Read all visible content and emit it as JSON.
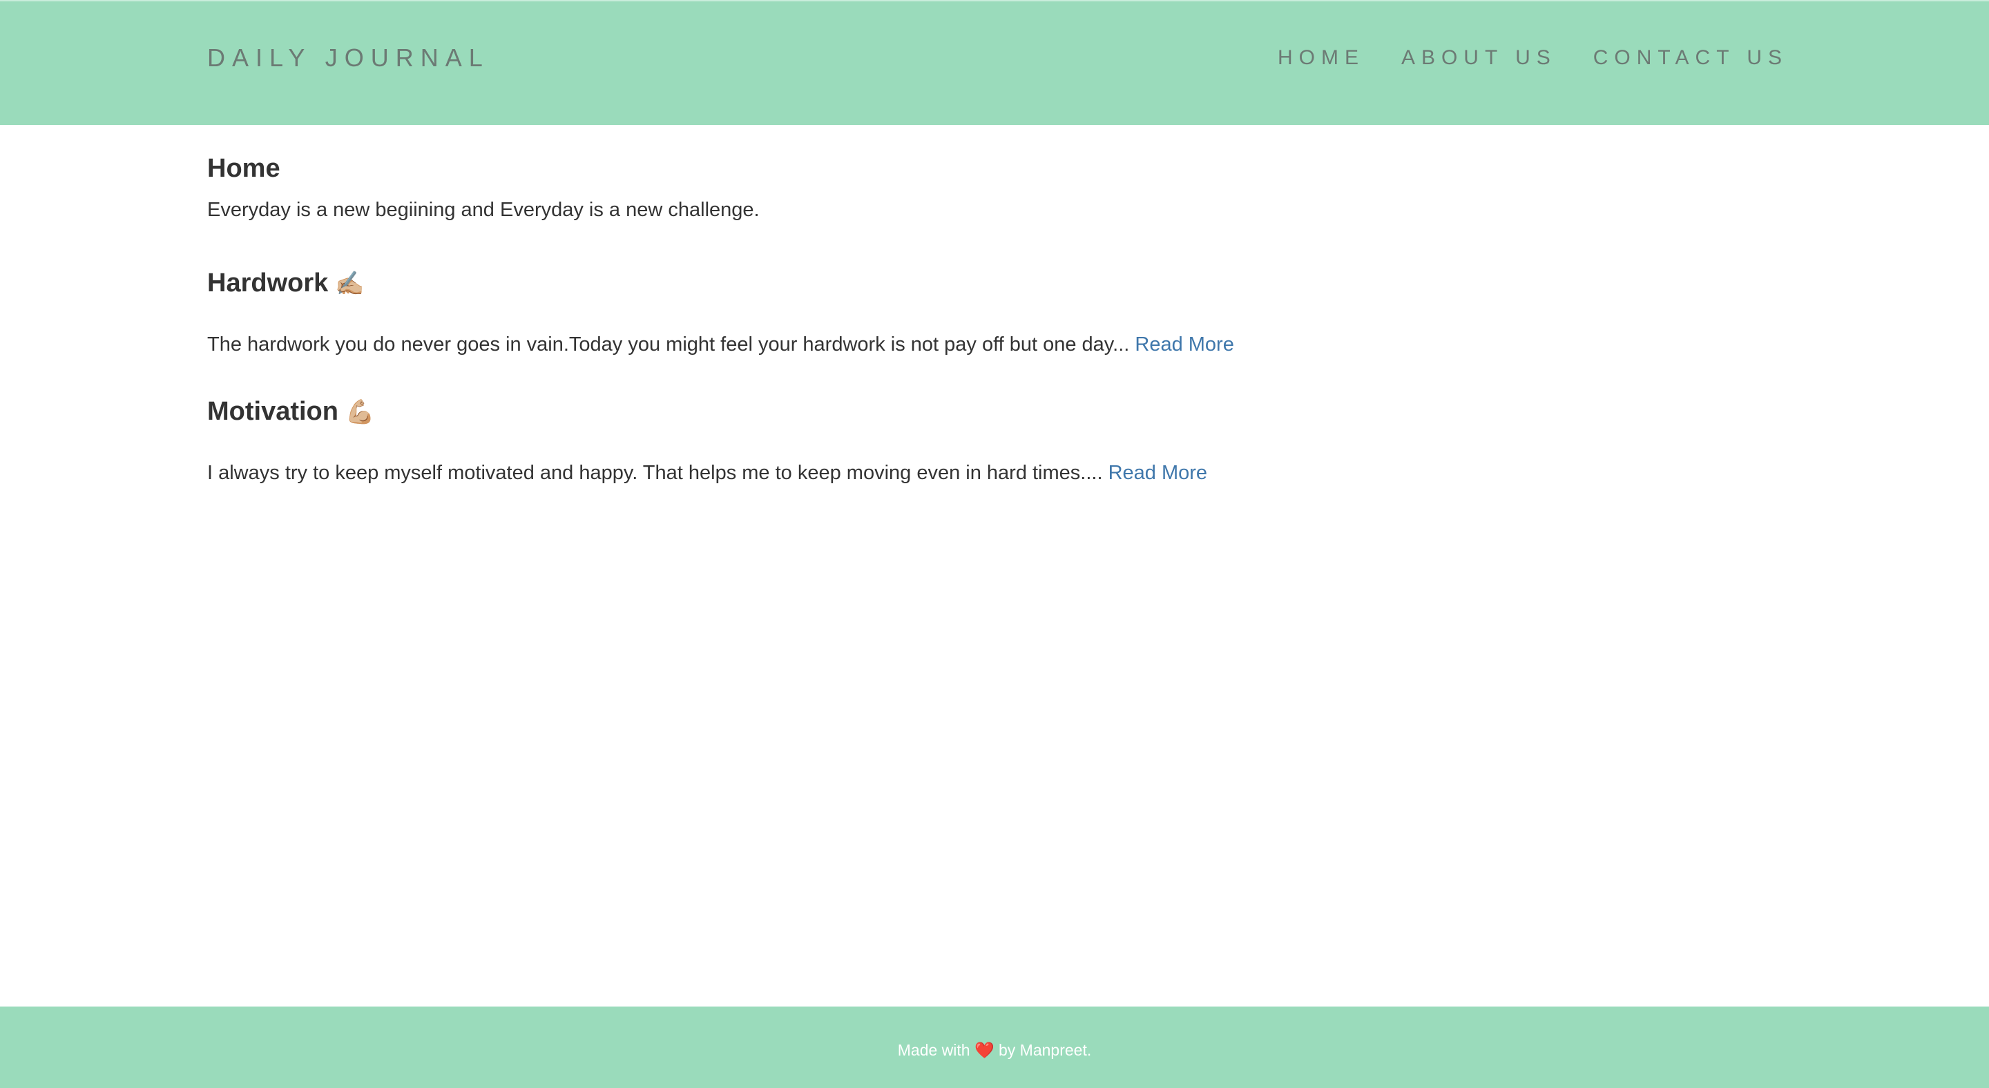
{
  "navbar": {
    "brand": "DAILY JOURNAL",
    "links": [
      {
        "label": "HOME"
      },
      {
        "label": "ABOUT US"
      },
      {
        "label": "CONTACT US"
      }
    ]
  },
  "main": {
    "title": "Home",
    "intro": "Everyday is a new begiining and Everyday is a new challenge.",
    "posts": [
      {
        "title": "Hardwork",
        "emoji": "✍🏼",
        "excerpt": "The hardwork you do never goes in vain.Today you might feel your hardwork is not pay off but one day... ",
        "read_more": "Read More"
      },
      {
        "title": "Motivation",
        "emoji": "💪🏼",
        "excerpt": "I always try to keep myself motivated and happy. That helps me to keep moving even in hard times.... ",
        "read_more": "Read More"
      }
    ]
  },
  "footer": {
    "prefix": "Made with ",
    "heart": "❤️",
    "suffix": " by Manpreet."
  },
  "colors": {
    "header_bg": "#9adbbb",
    "nav_text": "#6c7a74",
    "link": "#3f77ab",
    "body_text": "#333333",
    "footer_text": "#ffffff"
  }
}
